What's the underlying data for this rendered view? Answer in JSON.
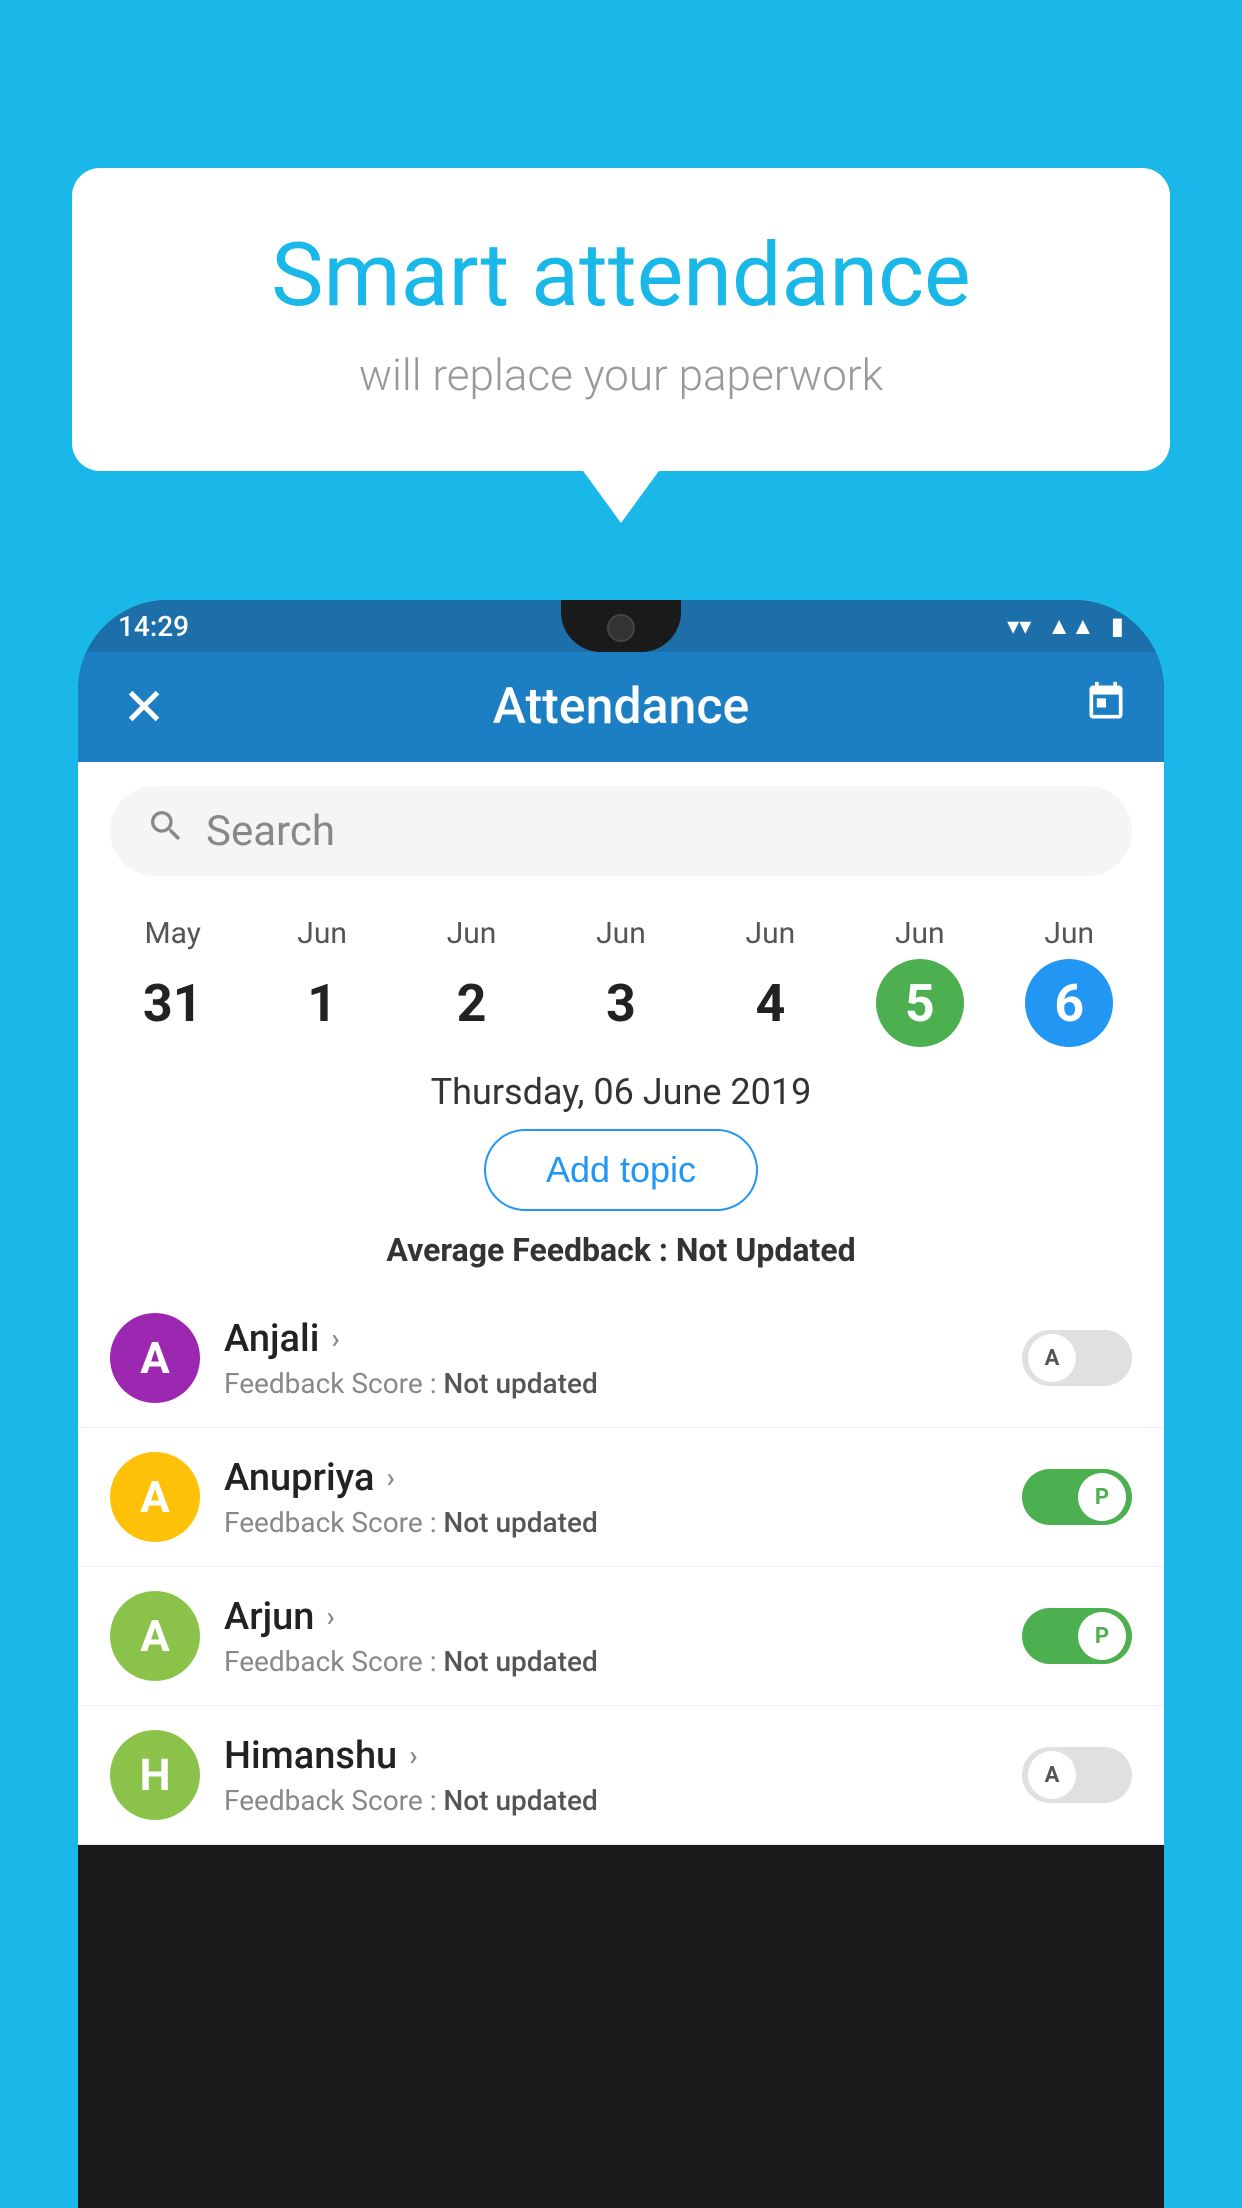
{
  "bubble": {
    "title": "Smart attendance",
    "subtitle": "will replace your paperwork"
  },
  "status_bar": {
    "time": "14:29",
    "wifi_icon": "▼",
    "signal_icon": "▲",
    "battery_icon": "▮"
  },
  "app_bar": {
    "close_label": "✕",
    "title": "Attendance",
    "calendar_icon": "📅"
  },
  "search": {
    "placeholder": "Search"
  },
  "calendar": {
    "days": [
      {
        "month": "May",
        "date": "31",
        "style": "normal"
      },
      {
        "month": "Jun",
        "date": "1",
        "style": "normal"
      },
      {
        "month": "Jun",
        "date": "2",
        "style": "normal"
      },
      {
        "month": "Jun",
        "date": "3",
        "style": "normal"
      },
      {
        "month": "Jun",
        "date": "4",
        "style": "normal"
      },
      {
        "month": "Jun",
        "date": "5",
        "style": "today-green"
      },
      {
        "month": "Jun",
        "date": "6",
        "style": "selected-blue"
      }
    ]
  },
  "selected_date": "Thursday, 06 June 2019",
  "add_topic_label": "Add topic",
  "avg_feedback_label": "Average Feedback : ",
  "avg_feedback_value": "Not Updated",
  "students": [
    {
      "name": "Anjali",
      "avatar_letter": "A",
      "avatar_color": "#9c27b0",
      "feedback_label": "Feedback Score : ",
      "feedback_value": "Not updated",
      "toggle": "off",
      "toggle_letter": "A"
    },
    {
      "name": "Anupriya",
      "avatar_letter": "A",
      "avatar_color": "#ffc107",
      "feedback_label": "Feedback Score : ",
      "feedback_value": "Not updated",
      "toggle": "on",
      "toggle_letter": "P"
    },
    {
      "name": "Arjun",
      "avatar_letter": "A",
      "avatar_color": "#8bc34a",
      "feedback_label": "Feedback Score : ",
      "feedback_value": "Not updated",
      "toggle": "on",
      "toggle_letter": "P"
    },
    {
      "name": "Himanshu",
      "avatar_letter": "H",
      "avatar_color": "#8bc34a",
      "feedback_label": "Feedback Score : ",
      "feedback_value": "Not updated",
      "toggle": "off",
      "toggle_letter": "A"
    }
  ]
}
